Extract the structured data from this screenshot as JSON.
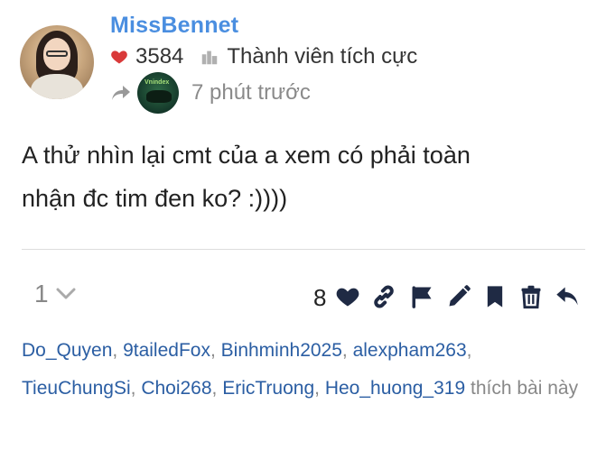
{
  "post": {
    "username": "MissBennet",
    "like_total": "3584",
    "user_title": "Thành viên tích cực",
    "time_ago": "7 phút trước",
    "content_line1": "A thử nhìn lại cmt của a xem có phải toàn",
    "content_line2": "nhận đc tim đen ko? :))))"
  },
  "actions": {
    "reply_count": "1",
    "like_count": "8",
    "icons": [
      "heart-icon",
      "link-icon",
      "flag-icon",
      "pencil-icon",
      "bookmark-icon",
      "trash-icon",
      "reply-icon"
    ]
  },
  "likers": {
    "users": [
      "Do_Quyen",
      "9tailedFox",
      "Binhminh2025",
      "alexpham263",
      "TieuChungSi",
      "Choi268",
      "EricTruong",
      "Heo_huong_319"
    ],
    "suffix": "thích bài này"
  },
  "colors": {
    "username": "#4a8ee0",
    "heart": "#d93a3a",
    "link": "#2b5ea3",
    "muted": "#8a8a8a"
  }
}
